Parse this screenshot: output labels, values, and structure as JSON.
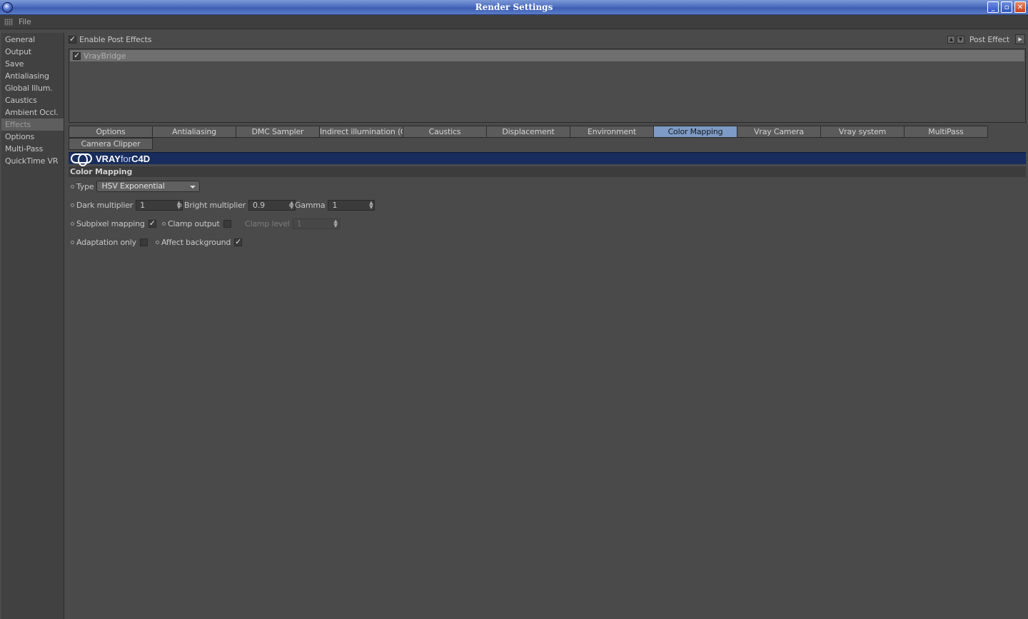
{
  "window": {
    "title": "Render Settings"
  },
  "menu": {
    "file": "File"
  },
  "sidebar": {
    "items": [
      {
        "label": "General"
      },
      {
        "label": "Output"
      },
      {
        "label": "Save"
      },
      {
        "label": "Antialiasing"
      },
      {
        "label": "Global Illum."
      },
      {
        "label": "Caustics"
      },
      {
        "label": "Ambient Occl."
      },
      {
        "label": "Effects"
      },
      {
        "label": "Options"
      },
      {
        "label": "Multi-Pass"
      },
      {
        "label": "QuickTime VR"
      }
    ],
    "active": "Effects"
  },
  "effects": {
    "enable_label": "Enable Post Effects",
    "enable_checked": true,
    "post_effect_label": "Post Effect",
    "list": [
      {
        "name": "VrayBridge",
        "checked": true
      }
    ]
  },
  "tabs": {
    "row1": [
      "Options",
      "Antialiasing",
      "DMC Sampler",
      "Indirect illumination (GI)",
      "Caustics",
      "Displacement",
      "Environment",
      "Color Mapping",
      "Vray Camera",
      "Vray system",
      "MultiPass"
    ],
    "row2": [
      "Camera Clipper"
    ],
    "active": "Color Mapping"
  },
  "banner": {
    "brand_a": "VRAY",
    "brand_b": "for",
    "brand_c": "C4D"
  },
  "color_mapping": {
    "section_title": "Color Mapping",
    "type_label": "Type",
    "type_value": "HSV Exponential",
    "dark_multiplier_label": "Dark multiplier",
    "dark_multiplier_value": "1",
    "bright_multiplier_label": "Bright multiplier",
    "bright_multiplier_value": "0.9",
    "gamma_label": "Gamma",
    "gamma_value": "1",
    "subpixel_label": "Subpixel mapping",
    "subpixel_checked": true,
    "clamp_output_label": "Clamp output",
    "clamp_output_checked": false,
    "clamp_level_label": "Clamp level",
    "clamp_level_value": "1",
    "adaptation_label": "Adaptation only",
    "adaptation_checked": false,
    "affect_bg_label": "Affect background",
    "affect_bg_checked": true
  },
  "colors": {
    "accent_tab": "#7d9bc6",
    "banner": "#182d5e",
    "background": "#4a4a4a"
  }
}
